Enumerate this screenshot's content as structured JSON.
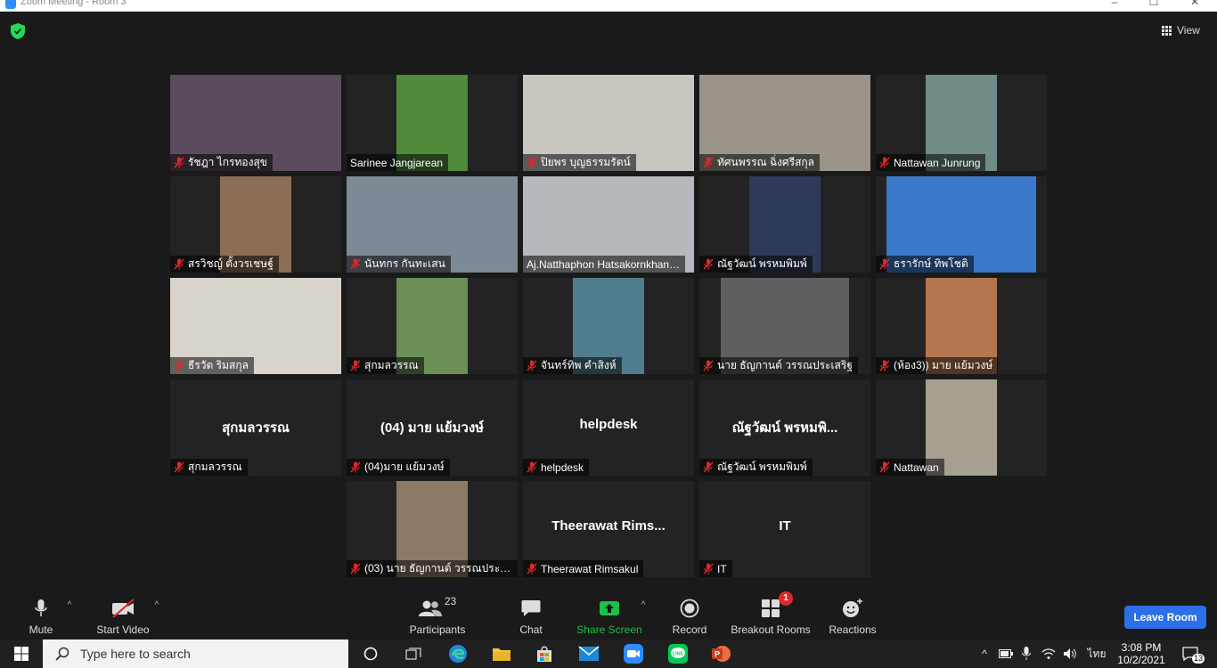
{
  "window": {
    "title": "Zoom Meeting - Room 3",
    "controls": [
      "–",
      "☐",
      "✕"
    ]
  },
  "header": {
    "view_label": "View"
  },
  "gallery": {
    "tiles": [
      {
        "name": "รัชฎา ไกรทองสุข",
        "big_name": "",
        "video": true,
        "muted": true,
        "active": false,
        "bg": "#5c4a5e"
      },
      {
        "name": "Sarinee Jangjarean",
        "big_name": "",
        "video": true,
        "muted": false,
        "active": false,
        "bg": "#4f8b3a"
      },
      {
        "name": "ปิยพร บุญธรรมรัตน์",
        "big_name": "",
        "video": true,
        "muted": true,
        "active": false,
        "bg": "#c9c6c0"
      },
      {
        "name": "ทัศนพรรณ ฉิ่งศรีสกุล",
        "big_name": "",
        "video": true,
        "muted": true,
        "active": false,
        "bg": "#9a948a"
      },
      {
        "name": "Nattawan Junrung",
        "big_name": "",
        "video": true,
        "muted": true,
        "active": false,
        "bg": "#6f8c88"
      },
      {
        "name": "สรวิชญ์ ตั้งวรเชษฐ์",
        "big_name": "",
        "video": true,
        "muted": true,
        "active": false,
        "bg": "#8c6e56"
      },
      {
        "name": "นันทกร กันทะเสน",
        "big_name": "",
        "video": true,
        "muted": true,
        "active": false,
        "bg": "#7d8a95"
      },
      {
        "name": "Aj.Natthaphon Hatsakornkhan…",
        "big_name": "",
        "video": true,
        "muted": false,
        "active": true,
        "bg": "#b5b8bd"
      },
      {
        "name": "ณัฐวัฒน์ พรหมพิมพ์",
        "big_name": "",
        "video": true,
        "muted": true,
        "active": false,
        "bg": "#2f3a5a"
      },
      {
        "name": "ธรารักษ์ ทิพโชติ",
        "big_name": "",
        "video": true,
        "muted": true,
        "active": false,
        "bg": "#3a78c9"
      },
      {
        "name": "ธีรวัต ริมสกุล",
        "big_name": "",
        "video": true,
        "muted": true,
        "active": false,
        "bg": "#d9d4cc"
      },
      {
        "name": "สุกมลวรรณ",
        "big_name": "",
        "video": true,
        "muted": true,
        "active": false,
        "bg": "#6b8f57"
      },
      {
        "name": "จันทร์ทิพ คำสิงห์",
        "big_name": "",
        "video": true,
        "muted": true,
        "active": false,
        "bg": "#4f7d8c"
      },
      {
        "name": "นาย ธัญกานต์ วรรณประเสริฐ",
        "big_name": "",
        "video": true,
        "muted": true,
        "active": false,
        "bg": "#5f5f62"
      },
      {
        "name": "(ห้อง3)) มาย แย้มวงษ์",
        "big_name": "",
        "video": true,
        "muted": true,
        "active": false,
        "bg": "#b3764e"
      },
      {
        "name": "สุกมลวรรณ",
        "big_name": "สุกมลวรรณ",
        "video": false,
        "muted": true,
        "active": false,
        "bg": "#232323"
      },
      {
        "name": "(04)มาย แย้มวงษ์",
        "big_name": "(04) มาย แย้มวงษ์",
        "video": false,
        "muted": true,
        "active": false,
        "bg": "#232323"
      },
      {
        "name": "helpdesk",
        "big_name": "helpdesk",
        "video": false,
        "muted": true,
        "active": false,
        "bg": "#232323"
      },
      {
        "name": "ณัฐวัฒน์ พรหมพิมพ์",
        "big_name": "ณัฐวัฒน์ พรหมพิ...",
        "video": false,
        "muted": true,
        "active": false,
        "bg": "#232323"
      },
      {
        "name": "Nattawan",
        "big_name": "",
        "video": true,
        "muted": true,
        "active": false,
        "bg": "#a5a08f"
      },
      {
        "name": "(03) นาย ธัญกานต์ วรรณประเส…",
        "big_name": "",
        "video": true,
        "muted": true,
        "active": false,
        "bg": "#8c7a66"
      },
      {
        "name": "Theerawat Rimsakul",
        "big_name": "Theerawat  Rims...",
        "video": false,
        "muted": true,
        "active": false,
        "bg": "#232323"
      },
      {
        "name": "IT",
        "big_name": "IT",
        "video": false,
        "muted": true,
        "active": false,
        "bg": "#232323"
      }
    ]
  },
  "toolbar": {
    "mute_label": "Mute",
    "video_label": "Start Video",
    "participants_label": "Participants",
    "participants_count": "23",
    "chat_label": "Chat",
    "share_label": "Share Screen",
    "record_label": "Record",
    "breakout_label": "Breakout Rooms",
    "breakout_badge": "1",
    "reactions_label": "Reactions",
    "leave_label": "Leave Room",
    "share_color": "#1fbf48",
    "leave_color": "#2d6fe8"
  },
  "taskbar": {
    "search_placeholder": "Type here to search",
    "lang": "ไทย",
    "time": "3:08 PM",
    "date": "10/2/2021",
    "notif_count": "13",
    "apps": [
      "task-view-icon",
      "edge-icon",
      "file-explorer-icon",
      "store-icon",
      "mail-icon",
      "zoom-icon",
      "line-icon",
      "powerpoint-icon"
    ]
  }
}
